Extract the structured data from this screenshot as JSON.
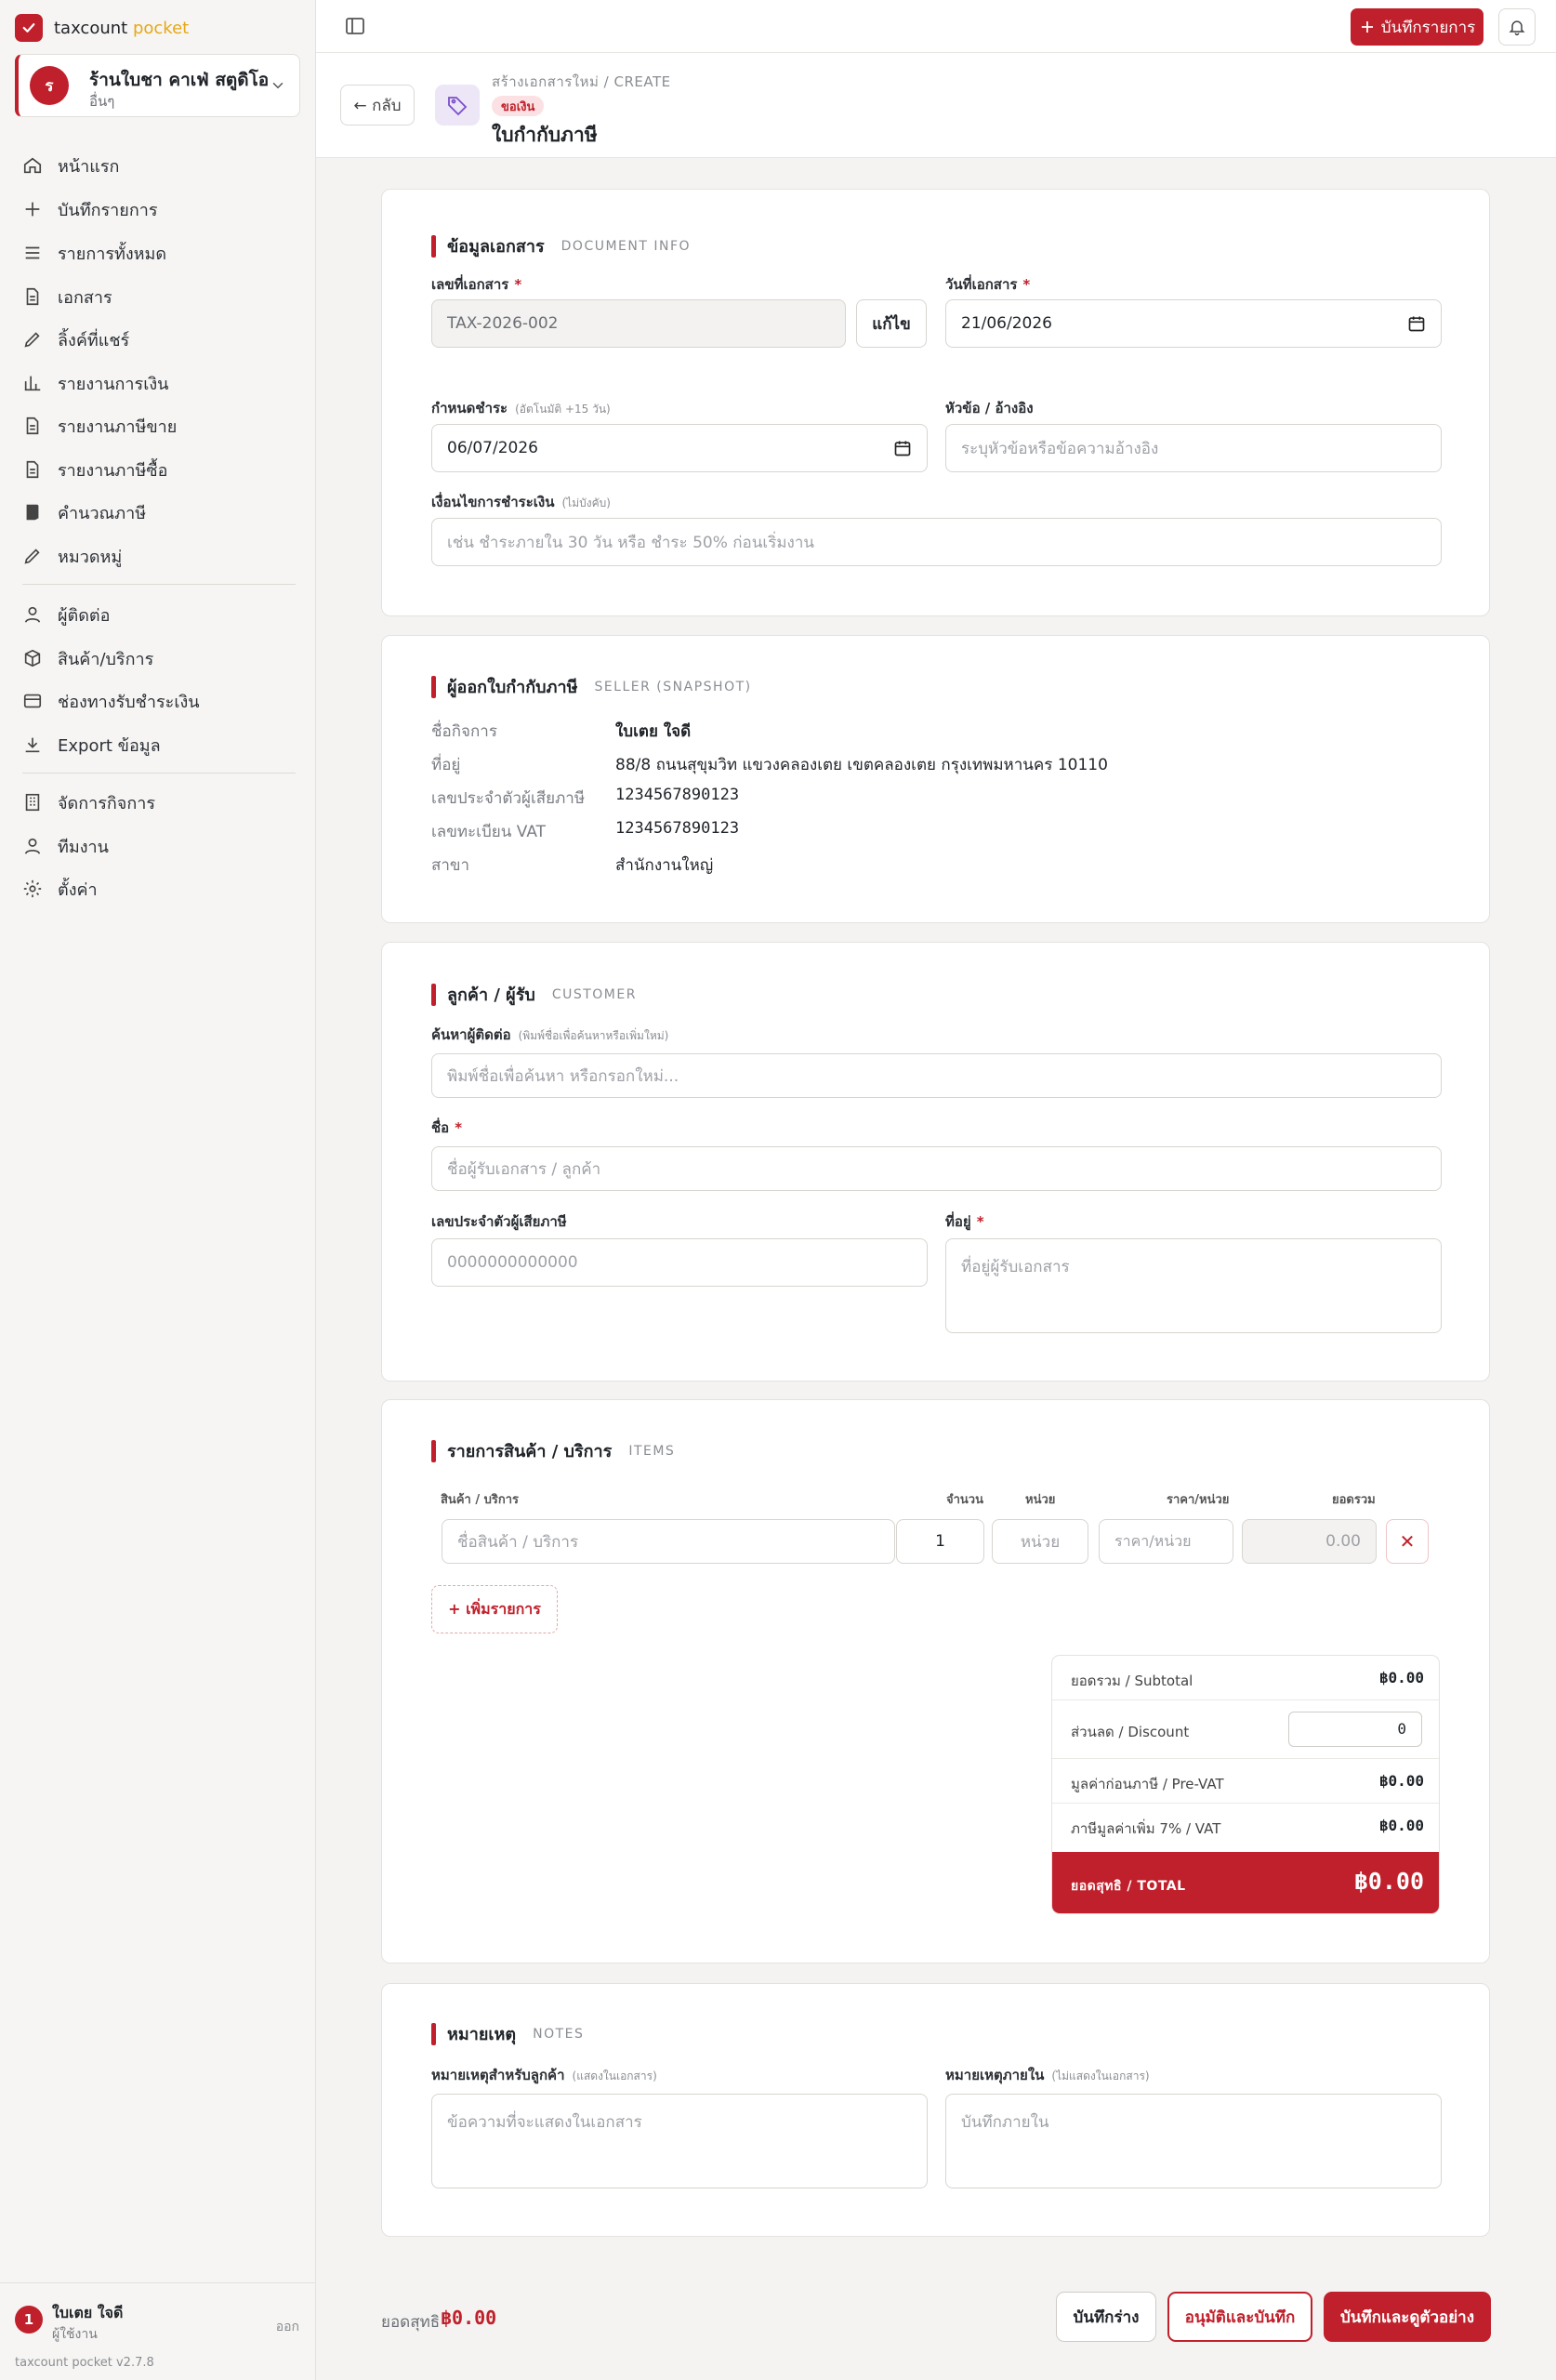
{
  "brand": {
    "name": "taxcount",
    "accent": "pocket"
  },
  "workspace": {
    "avatar": "ร",
    "name": "ร้านใบชา คาเฟ่ สตูดิโอ",
    "sub": "อื่นๆ"
  },
  "nav": [
    {
      "label": "หน้าแรก",
      "icon": "home-icon"
    },
    {
      "label": "บันทึกรายการ",
      "icon": "plus-icon"
    },
    {
      "label": "รายการทั้งหมด",
      "icon": "list-icon"
    },
    {
      "label": "เอกสาร",
      "icon": "document-icon"
    },
    {
      "label": "ลิ้งค์ที่แชร์",
      "icon": "pencil-icon"
    },
    {
      "label": "รายงานการเงิน",
      "icon": "bar-chart-icon"
    },
    {
      "label": "รายงานภาษีขาย",
      "icon": "document-icon"
    },
    {
      "label": "รายงานภาษีซื้อ",
      "icon": "document-icon"
    },
    {
      "label": "คำนวณภาษี",
      "icon": "calculator-icon"
    },
    {
      "label": "หมวดหมู่",
      "icon": "pencil-icon"
    }
  ],
  "nav2": [
    {
      "label": "ผู้ติดต่อ",
      "icon": "user-icon"
    },
    {
      "label": "สินค้า/บริการ",
      "icon": "box-icon"
    },
    {
      "label": "ช่องทางรับชำระเงิน",
      "icon": "credit-card-icon"
    },
    {
      "label": "Export ข้อมูล",
      "icon": "download-icon"
    }
  ],
  "nav3": [
    {
      "label": "จัดการกิจการ",
      "icon": "building-icon"
    },
    {
      "label": "ทีมงาน",
      "icon": "user-icon"
    },
    {
      "label": "ตั้งค่า",
      "icon": "gear-icon"
    }
  ],
  "user": {
    "avatar": "1",
    "name": "ใบเตย ใจดี",
    "role": "ผู้ใช้งาน",
    "logout": "ออก",
    "version": "taxcount pocket v2.7.8"
  },
  "topbar": {
    "record_label": "บันทึกรายการ"
  },
  "header": {
    "back": "← กลับ",
    "breadcrumb": "สร้างเอกสารใหม่ / CREATE",
    "badge": "ขอเงิน",
    "title": "ใบกำกับภาษี"
  },
  "doc_info": {
    "title": "ข้อมูลเอกสาร",
    "subtitle": "DOCUMENT INFO",
    "number_label": "เลขที่เอกสาร",
    "number_value": "TAX-2026-002",
    "edit": "แก้ไข",
    "date_label": "วันที่เอกสาร",
    "date_value": "21/06/2026",
    "due_label": "กำหนดชำระ",
    "due_hint": "(อัตโนมัติ +15 วัน)",
    "due_value": "06/07/2026",
    "ref_label": "หัวข้อ / อ้างอิง",
    "ref_placeholder": "ระบุหัวข้อหรือข้อความอ้างอิง",
    "terms_label": "เงื่อนไขการชำระเงิน",
    "terms_hint": "(ไม่บังคับ)",
    "terms_placeholder": "เช่น ชำระภายใน 30 วัน หรือ ชำระ 50% ก่อนเริ่มงาน"
  },
  "seller": {
    "title": "ผู้ออกใบกำกับภาษี",
    "subtitle": "SELLER (SNAPSHOT)",
    "rows": [
      {
        "k": "ชื่อกิจการ",
        "v": "ใบเตย ใจดี"
      },
      {
        "k": "ที่อยู่",
        "v": "88/8 ถนนสุขุมวิท แขวงคลองเตย เขตคลองเตย กรุงเทพมหานคร 10110"
      },
      {
        "k": "เลขประจำตัวผู้เสียภาษี",
        "v": "1234567890123"
      },
      {
        "k": "เลขทะเบียน VAT",
        "v": "1234567890123"
      },
      {
        "k": "สาขา",
        "v": "สำนักงานใหญ่"
      }
    ]
  },
  "customer": {
    "title": "ลูกค้า / ผู้รับ",
    "subtitle": "CUSTOMER",
    "search_label": "ค้นหาผู้ติดต่อ",
    "search_hint": "(พิมพ์ชื่อเพื่อค้นหาหรือเพิ่มใหม่)",
    "search_placeholder": "พิมพ์ชื่อเพื่อค้นหา หรือกรอกใหม่...",
    "name_label": "ชื่อ",
    "name_placeholder": "ชื่อผู้รับเอกสาร / ลูกค้า",
    "tax_label": "เลขประจำตัวผู้เสียภาษี",
    "tax_placeholder": "0000000000000",
    "addr_label": "ที่อยู่",
    "addr_placeholder": "ที่อยู่ผู้รับเอกสาร"
  },
  "items": {
    "title": "รายการสินค้า / บริการ",
    "subtitle": "ITEMS",
    "headers": {
      "product": "สินค้า / บริการ",
      "qty": "จำนวน",
      "unit": "หน่วย",
      "price": "ราคา/หน่วย",
      "total": "ยอดรวม"
    },
    "row": {
      "product_placeholder": "ชื่อสินค้า / บริการ",
      "qty": "1",
      "unit_placeholder": "หน่วย",
      "price_placeholder": "ราคา/หน่วย",
      "total": "0.00"
    },
    "add": "+ เพิ่มรายการ"
  },
  "totals": {
    "subtotal_label": "ยอดรวม / Subtotal",
    "subtotal": "฿0.00",
    "discount_label": "ส่วนลด / Discount",
    "discount": "0",
    "prevat_label": "มูลค่าก่อนภาษี / Pre-VAT",
    "prevat": "฿0.00",
    "vat_label": "ภาษีมูลค่าเพิ่ม 7% / VAT",
    "vat": "฿0.00",
    "total_label": "ยอดสุทธิ / TOTAL",
    "total": "฿0.00"
  },
  "notes": {
    "title": "หมายเหตุ",
    "subtitle": "NOTES",
    "customer_label": "หมายเหตุสำหรับลูกค้า",
    "customer_hint": "(แสดงในเอกสาร)",
    "customer_placeholder": "ข้อความที่จะแสดงในเอกสาร",
    "internal_label": "หมายเหตุภายใน",
    "internal_hint": "(ไม่แสดงในเอกสาร)",
    "internal_placeholder": "บันทึกภายใน"
  },
  "bottom": {
    "net_label": "ยอดสุทธิ",
    "net": "฿0.00",
    "draft": "บันทึกร่าง",
    "approve": "อนุมัติและบันทึก",
    "save_preview": "บันทึกและดูตัวอย่าง"
  },
  "colors": {
    "accent": "#c0202b",
    "accent_light": "#fbe1e3",
    "brand_secondary": "#e6a817"
  }
}
